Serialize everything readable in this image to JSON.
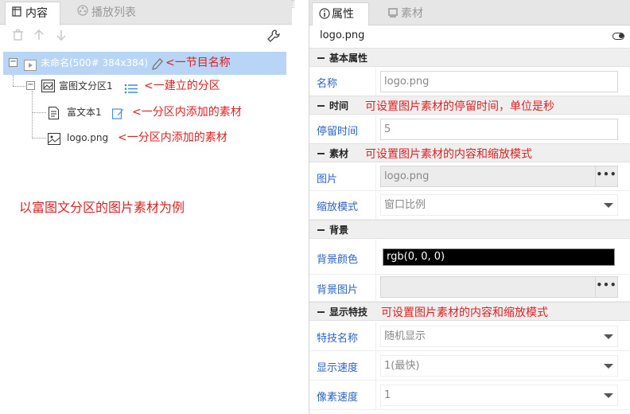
{
  "left_panel": {
    "tabs": [
      {
        "label": "内容",
        "icon": "content-icon",
        "active": true
      },
      {
        "label": "播放列表",
        "icon": "playlist-icon",
        "active": false
      }
    ],
    "toolbar": [
      "delete-icon",
      "arrow-up-icon",
      "arrow-down-icon",
      "wrench-icon"
    ],
    "tree": {
      "program": {
        "label": "未命名(500# 384x384)",
        "icon": "play-icon"
      },
      "section": {
        "label": "富图文分区1",
        "icon": "image-section-icon"
      },
      "items": [
        {
          "label": "富文本1",
          "icon": "document-icon"
        },
        {
          "label": "logo.png",
          "icon": "image-icon"
        }
      ]
    },
    "annotations": {
      "program": "<一节目名称",
      "section": "<一建立的分区",
      "item1": "<一分区内添加的素材",
      "item2": "<一分区内添加的素材"
    },
    "example_note": "以富图文分区的图片素材为例"
  },
  "right_panel": {
    "tabs": [
      {
        "label": "属性",
        "icon": "info-icon",
        "active": true
      },
      {
        "label": "素材",
        "icon": "material-icon",
        "active": false
      }
    ],
    "file_name": "logo.png",
    "sections": {
      "basic": {
        "title": "基本属性"
      },
      "time": {
        "title": "时间",
        "note": "可设置图片素材的停留时间，单位是秒"
      },
      "material": {
        "title": "素材",
        "note": "可设置图片素材的内容和缩放模式"
      },
      "background": {
        "title": "背景"
      },
      "effects": {
        "title": "显示特技",
        "note": "可设置图片素材的内容和缩放模式"
      }
    },
    "props": {
      "name": {
        "label": "名称",
        "value": "logo.png"
      },
      "stay_time": {
        "label": "停留时间",
        "value": "5"
      },
      "image": {
        "label": "图片",
        "value": "logo.png"
      },
      "zoom_mode": {
        "label": "缩放模式",
        "value": "窗口比例"
      },
      "bg_color": {
        "label": "背景颜色",
        "value": "rgb(0, 0, 0)"
      },
      "bg_image": {
        "label": "背景图片",
        "value": ""
      },
      "effect_name": {
        "label": "特技名称",
        "value": "随机显示"
      },
      "display_speed": {
        "label": "显示速度",
        "value": "1(最快)"
      },
      "pixel_speed": {
        "label": "像素速度",
        "value": "1"
      }
    }
  },
  "colors": {
    "annotation": "#e02020",
    "label_blue": "#2a63c5",
    "selection": "#b8d5f5"
  }
}
